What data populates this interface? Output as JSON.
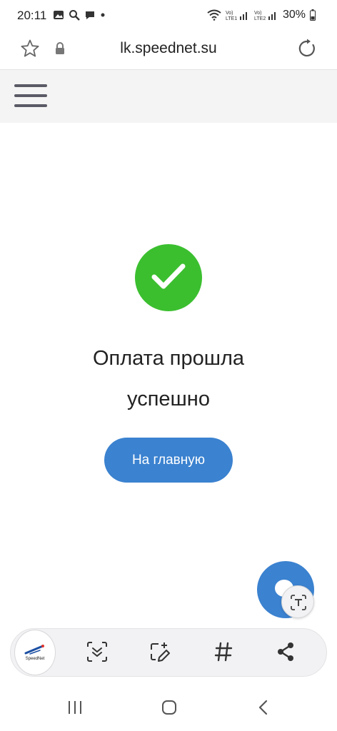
{
  "status_bar": {
    "time": "20:11",
    "battery": "30%",
    "icons": [
      "image-icon",
      "search-icon",
      "chat-icon",
      "dot-icon",
      "wifi-icon",
      "lte1-signal-icon",
      "lte2-signal-icon",
      "battery-icon"
    ]
  },
  "browser": {
    "url": "lk.speednet.su",
    "icons": [
      "star-icon",
      "lock-icon",
      "reload-icon"
    ]
  },
  "page": {
    "title_line1": "Оплата прошла",
    "title_line2": "успешно",
    "home_button": "На главную",
    "success_color": "#3bbf2f",
    "accent_color": "#3b82d0"
  },
  "toolbar": {
    "logo_text": "SpeedNet",
    "icons": [
      "scroll-capture-icon",
      "smart-select-icon",
      "tag-icon",
      "share-icon"
    ]
  },
  "nav": {
    "icons": [
      "recents-icon",
      "home-icon",
      "back-icon"
    ]
  }
}
